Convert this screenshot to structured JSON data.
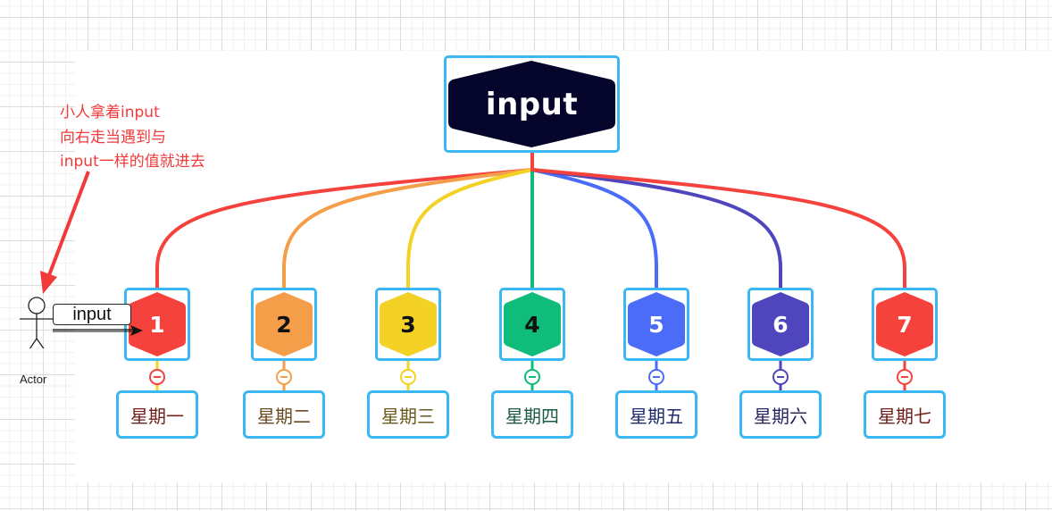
{
  "root": {
    "label": "input",
    "fill": "#05042a",
    "text_color": "#ffffff"
  },
  "frame_color": "#3bb8f3",
  "note": {
    "lines": [
      "小人拿着input",
      "向右走当遇到与",
      "input一样的值就进去"
    ],
    "color": "#f23a3a"
  },
  "actor": {
    "label": "Actor",
    "carried_tag": "input"
  },
  "children": [
    {
      "number": "1",
      "day": "星期一",
      "fill": "#f6423c",
      "num_color": "#ffffff",
      "line": "#f6423c",
      "stem_below": "#f3d125",
      "day_color": "#6e1f1a"
    },
    {
      "number": "2",
      "day": "星期二",
      "fill": "#f59e4a",
      "num_color": "#111111",
      "line": "#f59e4a",
      "stem_below": "#f59e4a",
      "day_color": "#6a4a22"
    },
    {
      "number": "3",
      "day": "星期三",
      "fill": "#f3d125",
      "num_color": "#111111",
      "line": "#f3d125",
      "stem_below": "#f3d125",
      "day_color": "#6b5a1c"
    },
    {
      "number": "4",
      "day": "星期四",
      "fill": "#0fbc79",
      "num_color": "#111111",
      "line": "#0fbc79",
      "stem_below": "#0fbc79",
      "day_color": "#1d5b46"
    },
    {
      "number": "5",
      "day": "星期五",
      "fill": "#4a6cf7",
      "num_color": "#ffffff",
      "line": "#4a6cf7",
      "stem_below": "#4a6cf7",
      "day_color": "#1e2a6a"
    },
    {
      "number": "6",
      "day": "星期六",
      "fill": "#4f46bd",
      "num_color": "#ffffff",
      "line": "#4f46bd",
      "stem_below": "#4f46bd",
      "day_color": "#2a2660"
    },
    {
      "number": "7",
      "day": "星期七",
      "fill": "#f6423c",
      "num_color": "#ffffff",
      "line": "#f6423c",
      "stem_below": "#f6423c",
      "day_color": "#6e1f1a"
    }
  ]
}
